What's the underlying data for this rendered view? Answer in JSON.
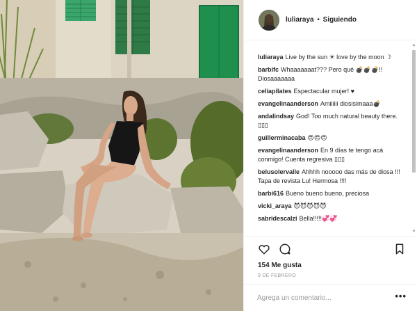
{
  "header": {
    "username": "luliaraya",
    "separator": "•",
    "follow_status": "Siguiendo"
  },
  "comments": [
    {
      "user": "luliaraya",
      "text": "Live by the sun ☀ love by the moon ☽"
    },
    {
      "user": "barbifc",
      "text": "Whaaaaaaat??? Pero qué 💣💣💣!! Diosaaaaaaa"
    },
    {
      "user": "celiapilates",
      "text": "Espectacular mujer! ♥"
    },
    {
      "user": "evangelinaanderson",
      "text": "Amiiiiii diosisimaaa💣"
    },
    {
      "user": "andalindsay",
      "text": "God! Too much natural beauty there. ▯▯▯"
    },
    {
      "user": "guillerminacaba",
      "text": "😍😍😍"
    },
    {
      "user": "evangelinaanderson",
      "text": "En 9 días te tengo acá conmigo! Cuenta regresiva ▯▯▯"
    },
    {
      "user": "belusolervalle",
      "text": "Ahhhh nooooo das más de diosa !!! Tapa de revista Lu! Hermosa !!!!"
    },
    {
      "user": "barbi616",
      "text": "Bueno bueno bueno, preciosa"
    },
    {
      "user": "vicki_araya",
      "text": "😈😈😈😈😈"
    },
    {
      "user": "sabridescalzi",
      "text": "Bella!!!!!💞💞"
    }
  ],
  "actions": {
    "like_icon": "heart-outline-icon",
    "comment_icon": "speech-bubble-icon",
    "save_icon": "bookmark-icon"
  },
  "likes_text": "154 Me gusta",
  "date_text": "9 DE FEBRERO",
  "comment_input": {
    "placeholder": "Agrega un comentario...",
    "value": ""
  },
  "more_label": "•••",
  "colors": {
    "text": "#262626",
    "muted": "#999999",
    "border": "#efefef",
    "door_green": "#1f8f4e"
  }
}
